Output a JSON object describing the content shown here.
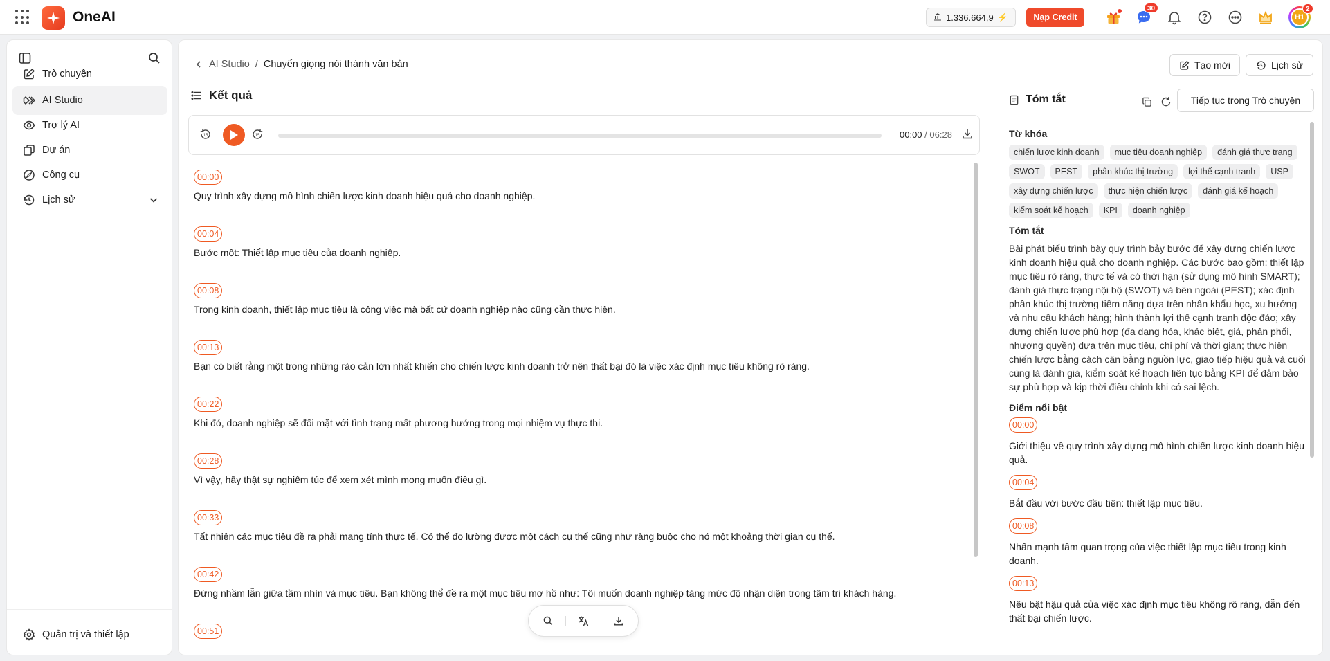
{
  "app": {
    "name": "OneAI",
    "credits": "1.336.664,9",
    "topup_label": "Nạp Credit",
    "chat_badge": "30",
    "avatar_initials": "H1",
    "avatar_badge": "2"
  },
  "sidebar": {
    "items": [
      {
        "label": "Trò chuyện"
      },
      {
        "label": "AI Studio"
      },
      {
        "label": "Trợ lý AI"
      },
      {
        "label": "Dự án"
      },
      {
        "label": "Công cụ"
      },
      {
        "label": "Lịch sử"
      }
    ],
    "footer_label": "Quản trị và thiết lập"
  },
  "breadcrumb": {
    "parent": "AI Studio",
    "separator": "/",
    "current": "Chuyển giọng nói thành văn bản"
  },
  "header_buttons": {
    "new_label": "Tạo mới",
    "history_label": "Lịch sử"
  },
  "results": {
    "title": "Kết quả"
  },
  "player": {
    "current_time": "00:00",
    "separator": " / ",
    "duration": "06:28",
    "progress": 0
  },
  "transcript": [
    {
      "time": "00:00",
      "text": "Quy trình xây dựng mô hình chiến lược kinh doanh hiệu quả cho doanh nghiệp."
    },
    {
      "time": "00:04",
      "text": "Bước một: Thiết lập mục tiêu của doanh nghiệp."
    },
    {
      "time": "00:08",
      "text": "Trong kinh doanh, thiết lập mục tiêu là công việc mà bất cứ doanh nghiệp nào cũng cần thực hiện."
    },
    {
      "time": "00:13",
      "text": "Bạn có biết rằng một trong những rào cản lớn nhất khiến cho chiến lược kinh doanh trở nên thất bại đó là việc xác định mục tiêu không rõ ràng."
    },
    {
      "time": "00:22",
      "text": "Khi đó, doanh nghiệp sẽ đối mặt với tình trạng mất phương hướng trong mọi nhiệm vụ thực thi."
    },
    {
      "time": "00:28",
      "text": "Vì vậy, hãy thật sự nghiêm túc để xem xét mình mong muốn điều gì."
    },
    {
      "time": "00:33",
      "text": "Tất nhiên các mục tiêu đề ra phải mang tính thực tế. Có thể đo lường được một cách cụ thể cũng như ràng buộc cho nó một khoảng thời gian cụ thể."
    },
    {
      "time": "00:42",
      "text": "Đừng nhầm lẫn giữa tầm nhìn và mục tiêu. Bạn không thể đề ra một mục tiêu mơ hồ như: Tôi muốn doanh nghiệp tăng mức độ nhận diện trong tâm trí khách hàng."
    },
    {
      "time": "00:51",
      "text": ""
    }
  ],
  "summary_panel": {
    "title": "Tóm tắt",
    "continue_label": "Tiếp tục trong Trò chuyện",
    "keywords_heading": "Từ khóa",
    "keywords": [
      "chiến lược kinh doanh",
      "mục tiêu doanh nghiệp",
      "đánh giá thực trạng",
      "SWOT",
      "PEST",
      "phân khúc thị trường",
      "lợi thế cạnh tranh",
      "USP",
      "xây dựng chiến lược",
      "thực hiện chiến lược",
      "đánh giá kế hoạch",
      "kiểm soát kế hoạch",
      "KPI",
      "doanh nghiệp"
    ],
    "summary_heading": "Tóm tắt",
    "summary_text": "Bài phát biểu trình bày quy trình bảy bước để xây dựng chiến lược kinh doanh hiệu quả cho doanh nghiệp. Các bước bao gồm: thiết lập mục tiêu rõ ràng, thực tế và có thời hạn (sử dụng mô hình SMART); đánh giá thực trạng nội bộ (SWOT) và bên ngoài (PEST); xác định phân khúc thị trường tiềm năng dựa trên nhân khẩu học, xu hướng và nhu cầu khách hàng; hình thành lợi thế cạnh tranh độc đáo; xây dựng chiến lược phù hợp (đa dạng hóa, khác biệt, giá, phân phối, nhượng quyền) dựa trên mục tiêu, chi phí và thời gian; thực hiện chiến lược bằng cách cân bằng nguồn lực, giao tiếp hiệu quả và cuối cùng là đánh giá, kiểm soát kế hoạch liên tục bằng KPI để đảm bảo sự phù hợp và kịp thời điều chỉnh khi có sai lệch.",
    "highlights_heading": "Điểm nổi bật",
    "highlights": [
      {
        "time": "00:00",
        "text": "Giới thiệu về quy trình xây dựng mô hình chiến lược kinh doanh hiệu quả."
      },
      {
        "time": "00:04",
        "text": "Bắt đầu với bước đầu tiên: thiết lập mục tiêu."
      },
      {
        "time": "00:08",
        "text": "Nhấn mạnh tầm quan trọng của việc thiết lập mục tiêu trong kinh doanh."
      },
      {
        "time": "00:13",
        "text": "Nêu bật hậu quả của việc xác định mục tiêu không rõ ràng, dẫn đến thất bại chiến lược."
      }
    ]
  },
  "colors": {
    "accent": "#ef5a23",
    "brand": "#ef4a2b"
  },
  "icons": [
    "apps-grid-icon",
    "oneai-logo",
    "bank-icon",
    "bolt-icon",
    "gift-icon",
    "chat-icon",
    "bell-icon",
    "help-icon",
    "more-icon",
    "crown-icon",
    "sidebar-toggle-icon",
    "search-icon",
    "edit-icon",
    "studio-icon",
    "assistant-icon",
    "project-icon",
    "tools-icon",
    "history-icon",
    "chevron-down-icon",
    "settings-icon",
    "back-icon",
    "list-icon",
    "rewind-15-icon",
    "play-icon",
    "forward-15-icon",
    "download-icon",
    "translate-icon",
    "document-icon",
    "copy-icon",
    "refresh-icon"
  ]
}
